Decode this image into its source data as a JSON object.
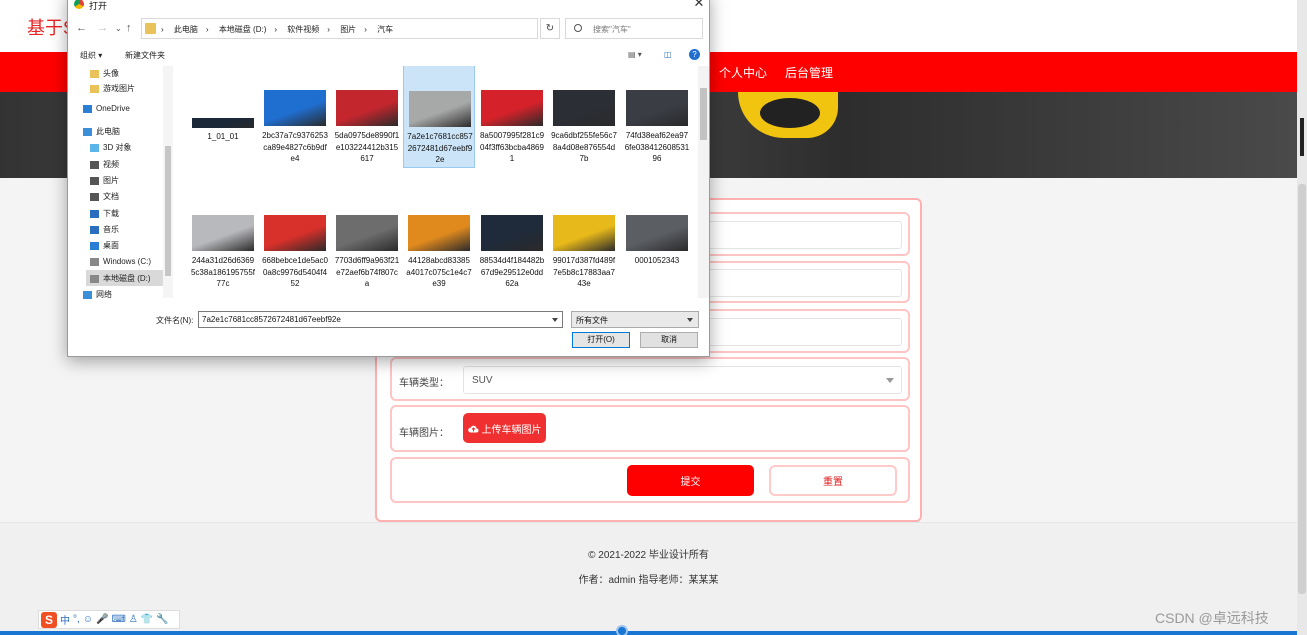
{
  "site": {
    "title": "基于S"
  },
  "nav": {
    "items": [
      "个人中心",
      "后台管理"
    ]
  },
  "form": {
    "rows": [
      {
        "label": "",
        "type": "text"
      },
      {
        "label": "",
        "type": "text"
      },
      {
        "label": "",
        "type": "text"
      }
    ],
    "vehicle_type_label": "车辆类型：",
    "vehicle_type_value": "SUV",
    "vehicle_image_label": "车辆图片：",
    "upload_button": "上传车辆图片",
    "submit_button": "提交",
    "reset_button": "重置"
  },
  "footer": {
    "copyright": "© 2021-2022 毕业设计所有",
    "author": "作者：admin 指导老师：某某某"
  },
  "watermark": "CSDN @卓远科技",
  "ime": {
    "label": "中",
    "punct": "°,"
  },
  "dialog": {
    "title": "打开",
    "close": "✕",
    "breadcrumb": [
      "此电脑",
      "本地磁盘 (D:)",
      "软件视频",
      "图片",
      "汽车"
    ],
    "search_placeholder": "搜索\"汽车\"",
    "toolbar": {
      "organize": "组织 ▾",
      "new_folder": "新建文件夹"
    },
    "tree": [
      {
        "label": "头像",
        "icon": "folder-icon"
      },
      {
        "label": "游戏图片",
        "icon": "folder-icon"
      },
      {
        "label": "OneDrive",
        "icon": "cloud-icon"
      },
      {
        "label": "此电脑",
        "icon": "computer-icon"
      },
      {
        "label": "3D 对象",
        "icon": "cube-icon"
      },
      {
        "label": "视频",
        "icon": "video-icon"
      },
      {
        "label": "图片",
        "icon": "picture-icon"
      },
      {
        "label": "文档",
        "icon": "document-icon"
      },
      {
        "label": "下载",
        "icon": "download-icon"
      },
      {
        "label": "音乐",
        "icon": "music-icon"
      },
      {
        "label": "桌面",
        "icon": "desktop-icon"
      },
      {
        "label": "Windows (C:)",
        "icon": "drive-icon"
      },
      {
        "label": "本地磁盘 (D:)",
        "icon": "drive-icon"
      },
      {
        "label": "网络",
        "icon": "network-icon"
      }
    ],
    "files": [
      {
        "name": "1_01_01",
        "color": "#1a2838"
      },
      {
        "name": "2bc37a7c9376253ca89e4827c6b9dfe4",
        "color": "#1f6fd1"
      },
      {
        "name": "5da0975de8990f1e103224412b315617",
        "color": "#c4262e"
      },
      {
        "name": "7a2e1c7681cc8572672481d67eebf92e",
        "color": "#a7a8a8"
      },
      {
        "name": "8a5007995f281c904f3ff63bcba48691",
        "color": "#d5222a"
      },
      {
        "name": "9ca6dbf255fe56c78a4d08e876554d7b",
        "color": "#2b2e35"
      },
      {
        "name": "74fd38eaf62ea976fe03841260853196",
        "color": "#3a3d44"
      },
      {
        "name": "244a31d26d63695c38a186195755f77c",
        "color": "#b8b9bd"
      },
      {
        "name": "668bebce1de5ac00a8c9976d5404f452",
        "color": "#d8302a"
      },
      {
        "name": "7703d6ff9a963f21e72aef6b74f807ca",
        "color": "#6d6d6d"
      },
      {
        "name": "44128abcd83385a4017c075c1e4c7e39",
        "color": "#e08a1e"
      },
      {
        "name": "88534d4f184482b67d9e29512e0dd62a",
        "color": "#1f2a3a"
      },
      {
        "name": "99017d387fd489f7e5b8c17883aa743e",
        "color": "#e8b91a"
      },
      {
        "name": "0001052343",
        "color": "#5b5e63"
      },
      {
        "name": "",
        "color": "#cfd5dd"
      },
      {
        "name": "",
        "color": "#ffffff"
      },
      {
        "name": "",
        "color": "#2f8ee0"
      },
      {
        "name": "",
        "color": "#aab0b6"
      },
      {
        "name": "",
        "color": "#ffffff"
      },
      {
        "name": "",
        "color": "#ffffff"
      },
      {
        "name": "",
        "color": "#6b7a4a"
      }
    ],
    "filename_label": "文件名(N):",
    "filename_value": "7a2e1c7681cc8572672481d67eebf92e",
    "filetype_value": "所有文件",
    "open_button": "打开(O)",
    "cancel_button": "取消"
  }
}
